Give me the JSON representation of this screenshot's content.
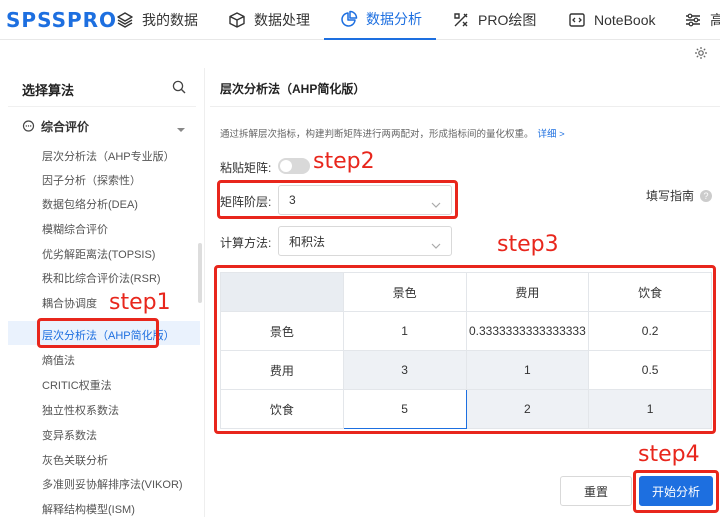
{
  "app": {
    "logo": "SPSSPRO"
  },
  "nav": [
    {
      "label": "我的数据",
      "icon": "layers-icon",
      "active": false
    },
    {
      "label": "数据处理",
      "icon": "cube-icon",
      "active": false
    },
    {
      "label": "数据分析",
      "icon": "pie-chart-icon",
      "active": true
    },
    {
      "label": "PRO绘图",
      "icon": "draw-tools-icon",
      "active": false
    },
    {
      "label": "NoteBook",
      "icon": "code-icon",
      "active": false
    },
    {
      "label": "高",
      "icon": "sliders-icon",
      "active": false
    }
  ],
  "sidebar": {
    "title": "选择算法",
    "group": "综合评价",
    "items": [
      {
        "label": "层次分析法（AHP专业版）"
      },
      {
        "label": "因子分析（探索性）"
      },
      {
        "label": "数据包络分析(DEA)"
      },
      {
        "label": "模糊综合评价"
      },
      {
        "label": "优劣解距离法(TOPSIS)"
      },
      {
        "label": "秩和比综合评价法(RSR)"
      },
      {
        "label": "耦合协调度"
      },
      {
        "label": "层次分析法（AHP简化版）",
        "selected": true
      },
      {
        "label": "熵值法"
      },
      {
        "label": "CRITIC权重法"
      },
      {
        "label": "独立性权系数法"
      },
      {
        "label": "变异系数法"
      },
      {
        "label": "灰色关联分析"
      },
      {
        "label": "多准则妥协解排序法(VIKOR)"
      },
      {
        "label": "解释结构模型(ISM)"
      }
    ]
  },
  "main": {
    "title": "层次分析法（AHP简化版）",
    "description": "通过拆解层次指标，构建判断矩阵进行两两配对，形成指标间的量化权重。",
    "more_link": "详细 >",
    "paste_matrix_label": "粘贴矩阵:",
    "paste_matrix_enabled": false,
    "order_label": "矩阵阶层:",
    "order_value": "3",
    "method_label": "计算方法:",
    "method_value": "和积法",
    "guide_label": "填写指南",
    "guide_icon": "?"
  },
  "matrix": {
    "columns": [
      "景色",
      "费用",
      "饮食"
    ],
    "rows": [
      {
        "label": "景色",
        "values": [
          "1",
          "0.3333333333333333",
          "0.2"
        ]
      },
      {
        "label": "费用",
        "values": [
          "3",
          "1",
          "0.5"
        ]
      },
      {
        "label": "饮食",
        "values": [
          "5",
          "2",
          "1"
        ]
      }
    ]
  },
  "buttons": {
    "reset": "重置",
    "start": "开始分析"
  },
  "annotations": {
    "step1": "step1",
    "step2": "step2",
    "step3": "step3",
    "step4": "step4"
  },
  "colors": {
    "accent": "#1d6fe0",
    "annotation": "#e8261c"
  }
}
